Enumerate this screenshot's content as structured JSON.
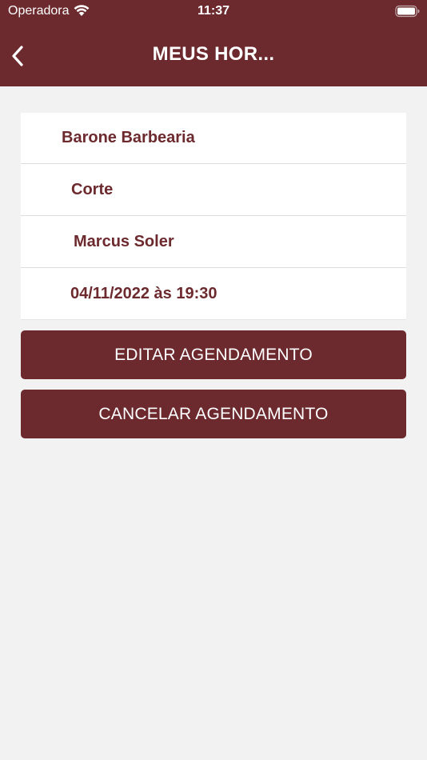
{
  "status_bar": {
    "carrier": "Operadora",
    "time": "11:37"
  },
  "header": {
    "title": "MEUS HOR...",
    "back_icon": "chevron-left-icon",
    "background_color": "#6c2a2e"
  },
  "appointment": {
    "shop": "Barone Barbearia",
    "service": "Corte",
    "barber": "Marcus Soler",
    "datetime": "04/11/2022 às 19:30"
  },
  "actions": {
    "edit_label": "EDITAR AGENDAMENTO",
    "cancel_label": "CANCELAR AGENDAMENTO"
  },
  "colors": {
    "accent": "#6c2a2e",
    "background": "#f2f2f2",
    "card": "#ffffff"
  }
}
